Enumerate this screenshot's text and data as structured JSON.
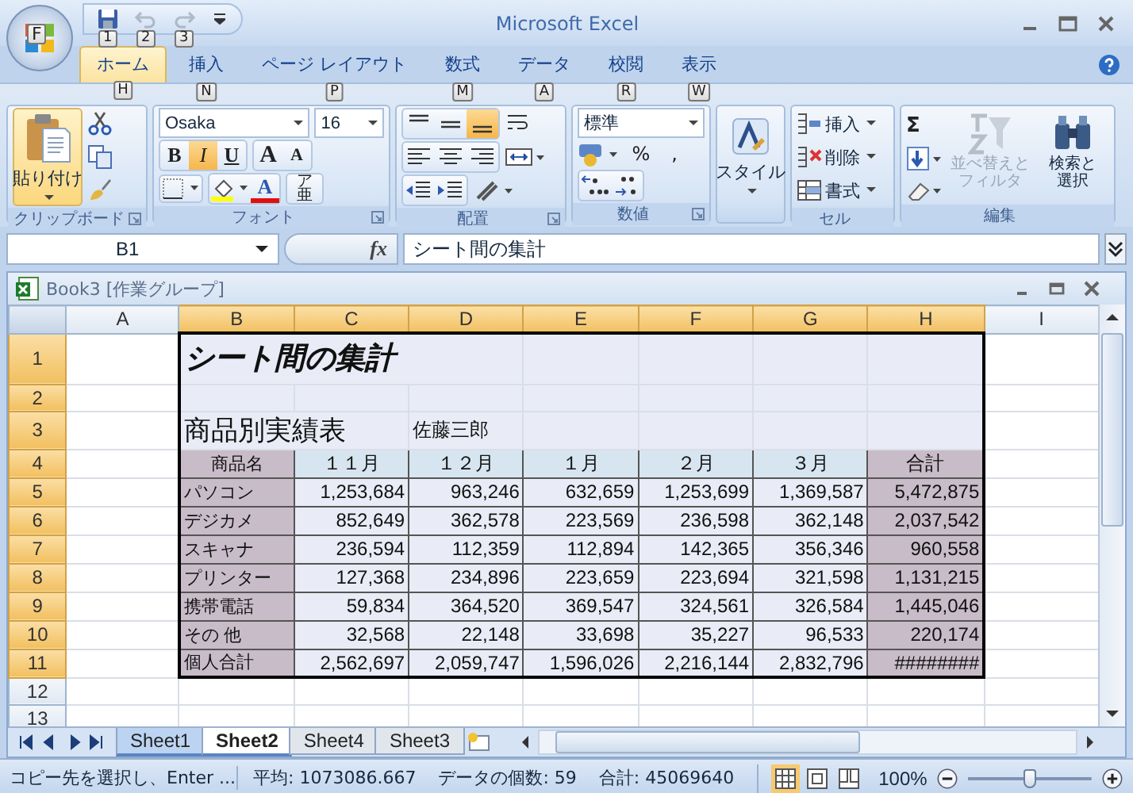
{
  "window": {
    "title": "Microsoft Excel"
  },
  "office_button": {
    "keytip": "F"
  },
  "quick_access": [
    {
      "keytip": "1",
      "disabled": false
    },
    {
      "keytip": "2",
      "disabled": true
    },
    {
      "keytip": "3",
      "disabled": true
    }
  ],
  "tabs": [
    {
      "label": "ホーム",
      "keytip": "H",
      "selected": true
    },
    {
      "label": "挿入",
      "keytip": "N",
      "selected": false
    },
    {
      "label": "ページ レイアウト",
      "keytip": "P",
      "selected": false
    },
    {
      "label": "数式",
      "keytip": "M",
      "selected": false
    },
    {
      "label": "データ",
      "keytip": "A",
      "selected": false
    },
    {
      "label": "校閲",
      "keytip": "R",
      "selected": false
    },
    {
      "label": "表示",
      "keytip": "W",
      "selected": false
    }
  ],
  "clipboard": {
    "label": "クリップボード",
    "paste": "貼り付け"
  },
  "font": {
    "label": "フォント",
    "font_name": "Osaka",
    "font_size": "16",
    "bold": {
      "text": "B",
      "on": false
    },
    "italic": {
      "text": "I",
      "on": true
    },
    "underline": {
      "text": "U",
      "on": false
    },
    "grow": "A",
    "shrink": "A",
    "color_letter": "A",
    "phonetic": {
      "small": "ア",
      "big": "亜"
    }
  },
  "alignment": {
    "label": "配置",
    "vertical": [
      {
        "selected": false
      },
      {
        "selected": false
      },
      {
        "selected": true
      }
    ]
  },
  "number": {
    "label": "数値",
    "format": "標準",
    "percent": "%",
    "comma": ","
  },
  "styles": {
    "button": "スタイル"
  },
  "cells": {
    "label": "セル",
    "buttons": [
      {
        "label": "挿入",
        "kind": "insert"
      },
      {
        "label": "削除",
        "kind": "delete"
      },
      {
        "label": "書式",
        "kind": "format"
      }
    ]
  },
  "editing": {
    "label": "編集",
    "sum": "Σ",
    "sort": {
      "lines": [
        "並べ替えと",
        "フィルタ"
      ],
      "disabled": true
    },
    "find": {
      "lines": [
        "検索と",
        "選択"
      ],
      "disabled": false
    }
  },
  "formula_bar": {
    "name_box": "B1",
    "fx": "fx",
    "formula": "シート間の集計"
  },
  "workbook": {
    "title": "Book3 [作業グループ]"
  },
  "sheet": {
    "columns": [
      {
        "label": "A",
        "selected": false
      },
      {
        "label": "B",
        "selected": true
      },
      {
        "label": "C",
        "selected": true
      },
      {
        "label": "D",
        "selected": true
      },
      {
        "label": "E",
        "selected": true
      },
      {
        "label": "F",
        "selected": true
      },
      {
        "label": "G",
        "selected": true
      },
      {
        "label": "H",
        "selected": true
      },
      {
        "label": "I",
        "selected": false
      }
    ],
    "rows": [
      {
        "header": "1",
        "kind": "title",
        "selected": true,
        "cells": [
          "シート間の集計"
        ]
      },
      {
        "header": "2",
        "kind": "blank",
        "selected": true
      },
      {
        "header": "3",
        "kind": "subtitle",
        "selected": true,
        "cells": [
          "商品別実績表",
          "佐藤三郎"
        ]
      },
      {
        "header": "4",
        "kind": "head",
        "selected": true,
        "cells": [
          "商品名",
          "１１月",
          "１２月",
          "１月",
          "２月",
          "３月",
          "合計"
        ]
      },
      {
        "header": "5",
        "kind": "data",
        "selected": true,
        "cells": [
          "パソコン",
          "1,253,684",
          "963,246",
          "632,659",
          "1,253,699",
          "1,369,587",
          "5,472,875"
        ]
      },
      {
        "header": "6",
        "kind": "data",
        "selected": true,
        "cells": [
          "デジカメ",
          "852,649",
          "362,578",
          "223,569",
          "236,598",
          "362,148",
          "2,037,542"
        ]
      },
      {
        "header": "7",
        "kind": "data",
        "selected": true,
        "cells": [
          "スキャナ",
          "236,594",
          "112,359",
          "112,894",
          "142,365",
          "356,346",
          "960,558"
        ]
      },
      {
        "header": "8",
        "kind": "data",
        "selected": true,
        "cells": [
          "プリンター",
          "127,368",
          "234,896",
          "223,659",
          "223,694",
          "321,598",
          "1,131,215"
        ]
      },
      {
        "header": "9",
        "kind": "data",
        "selected": true,
        "cells": [
          "携帯電話",
          "59,834",
          "364,520",
          "369,547",
          "324,561",
          "326,584",
          "1,445,046"
        ]
      },
      {
        "header": "10",
        "kind": "data",
        "selected": true,
        "cells": [
          "その 他",
          "32,568",
          "22,148",
          "33,698",
          "35,227",
          "96,533",
          "220,174"
        ]
      },
      {
        "header": "11",
        "kind": "total",
        "selected": true,
        "cells": [
          "個人合計",
          "2,562,697",
          "2,059,747",
          "1,596,026",
          "2,216,144",
          "2,832,796",
          "########"
        ]
      },
      {
        "header": "12",
        "kind": "blank",
        "selected": false
      },
      {
        "header": "13",
        "kind": "blank",
        "selected": false
      }
    ]
  },
  "sheet_tabs": [
    {
      "label": "Sheet1",
      "selected": true,
      "active": false
    },
    {
      "label": "Sheet2",
      "selected": true,
      "active": true
    },
    {
      "label": "Sheet4",
      "selected": false,
      "active": false
    },
    {
      "label": "Sheet3",
      "selected": false,
      "active": false
    }
  ],
  "status_bar": {
    "message": "コピー先を選択し、Enter ...",
    "average": "平均: 1073086.667",
    "count": "データの個数: 59",
    "sum": "合計: 45069640",
    "views": [
      {
        "selected": true
      },
      {
        "selected": false
      },
      {
        "selected": false
      }
    ],
    "zoom": "100%",
    "zoom_slider": {
      "level": 0.5
    }
  }
}
